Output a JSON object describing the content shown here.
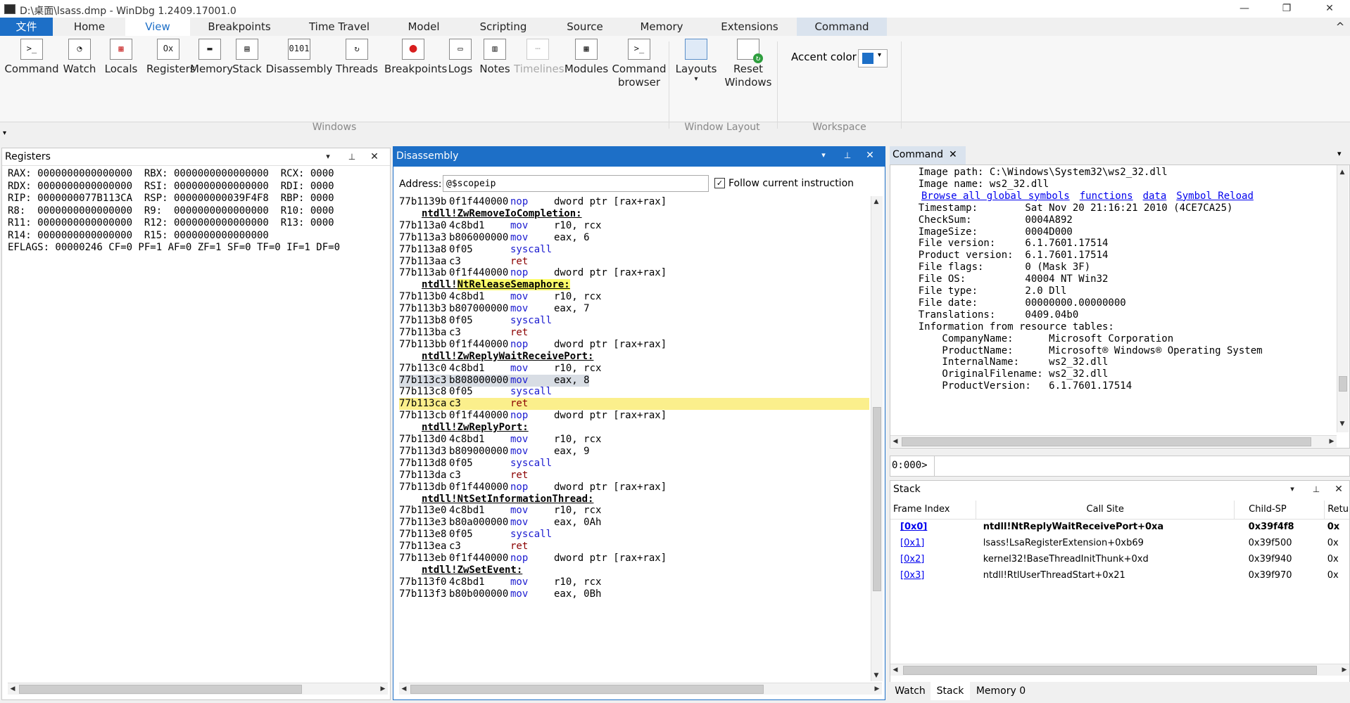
{
  "window": {
    "title": "D:\\桌面\\lsass.dmp - WinDbg 1.2409.17001.0",
    "minimize": "—",
    "maximize": "❐",
    "close": "✕",
    "collapse_ribbon": "^"
  },
  "tabs": [
    "文件",
    "Home",
    "View",
    "Breakpoints",
    "Time Travel",
    "Model",
    "Scripting",
    "Source",
    "Memory",
    "Extensions",
    "Command"
  ],
  "ribbon": {
    "windows_buttons": [
      {
        "label": "Command",
        "icon": "command-icon",
        "glyph": ">_"
      },
      {
        "label": "Watch",
        "icon": "watch-icon",
        "glyph": "◔"
      },
      {
        "label": "Locals",
        "icon": "locals-icon",
        "glyph": "▦"
      },
      {
        "label": "Registers",
        "icon": "registers-icon",
        "glyph": "Ox"
      },
      {
        "label": "Memory",
        "icon": "memory-icon",
        "glyph": "▬"
      },
      {
        "label": "Stack",
        "icon": "stack-icon",
        "glyph": "▤"
      },
      {
        "label": "Disassembly",
        "icon": "disassembly-icon",
        "glyph": "0101"
      },
      {
        "label": "Threads",
        "icon": "threads-icon",
        "glyph": "↻"
      },
      {
        "label": "Breakpoints",
        "icon": "breakpoint-icon",
        "glyph": "●"
      },
      {
        "label": "Logs",
        "icon": "logs-icon",
        "glyph": "▭"
      },
      {
        "label": "Notes",
        "icon": "notes-icon",
        "glyph": "▥"
      },
      {
        "label": "Timelines",
        "icon": "timelines-icon",
        "glyph": "⋯"
      },
      {
        "label": "Modules",
        "icon": "modules-icon",
        "glyph": "▦"
      },
      {
        "label": "Command\nbrowser",
        "icon": "command-browser-icon",
        "glyph": ">_"
      }
    ],
    "layouts_label": "Layouts",
    "layouts_arrow": "▾",
    "reset_windows_label": "Reset\nWindows",
    "accent_color_label": "Accent color",
    "accent_color": "#1d6fc7",
    "dropdown_arrow": "▾",
    "group_windows": "Windows",
    "group_window_layout": "Window Layout",
    "group_workspace": "Workspace",
    "quick_toggle": "▾"
  },
  "registers": {
    "title": "Registers",
    "dropdown": "▾",
    "pin": "📌",
    "close": "✕",
    "lines": [
      "RAX: 0000000000000000  RBX: 0000000000000000  RCX: 0000",
      "RDX: 0000000000000000  RSI: 0000000000000000  RDI: 0000",
      "RIP: 0000000077B113CA  RSP: 000000000039F4F8  RBP: 0000",
      "R8:  0000000000000000  R9:  0000000000000000  R10: 0000",
      "R11: 0000000000000000  R12: 0000000000000000  R13: 0000",
      "R14: 0000000000000000  R15: 0000000000000000",
      "EFLAGS: 00000246 CF=0 PF=1 AF=0 ZF=1 SF=0 TF=0 IF=1 DF=0"
    ]
  },
  "disassembly": {
    "title": "Disassembly",
    "dropdown": "▾",
    "pin": "📌",
    "close": "✕",
    "address_label": "Address:",
    "address_value": "@$scopeip",
    "follow_label": "Follow current instruction",
    "follow_checked": true,
    "current_line_color": "#fbef8c",
    "selected_line_color": "#d8dde4",
    "label_highlight_color": "#fdfd6a",
    "lines": [
      {
        "kind": "ins",
        "addr": "77b1139b",
        "bytes": "0f1f440000",
        "op": "nop",
        "args": "dword ptr [rax+rax]"
      },
      {
        "kind": "label",
        "text": "ntdll!ZwRemoveIoCompletion:"
      },
      {
        "kind": "ins",
        "addr": "77b113a0",
        "bytes": "4c8bd1",
        "op": "mov",
        "args": "r10, rcx"
      },
      {
        "kind": "ins",
        "addr": "77b113a3",
        "bytes": "b806000000",
        "op": "mov",
        "args": "eax, 6"
      },
      {
        "kind": "ins",
        "addr": "77b113a8",
        "bytes": "0f05",
        "op": "syscall",
        "args": ""
      },
      {
        "kind": "ins",
        "addr": "77b113aa",
        "bytes": "c3",
        "op": "ret",
        "args": ""
      },
      {
        "kind": "ins",
        "addr": "77b113ab",
        "bytes": "0f1f440000",
        "op": "nop",
        "args": "dword ptr [rax+rax]"
      },
      {
        "kind": "label",
        "text": "ntdll!NtReleaseSemaphore:",
        "prefix": "ntdll!",
        "hl": "NtReleaseSemaphore:"
      },
      {
        "kind": "ins",
        "addr": "77b113b0",
        "bytes": "4c8bd1",
        "op": "mov",
        "args": "r10, rcx"
      },
      {
        "kind": "ins",
        "addr": "77b113b3",
        "bytes": "b807000000",
        "op": "mov",
        "args": "eax, 7"
      },
      {
        "kind": "ins",
        "addr": "77b113b8",
        "bytes": "0f05",
        "op": "syscall",
        "args": ""
      },
      {
        "kind": "ins",
        "addr": "77b113ba",
        "bytes": "c3",
        "op": "ret",
        "args": ""
      },
      {
        "kind": "ins",
        "addr": "77b113bb",
        "bytes": "0f1f440000",
        "op": "nop",
        "args": "dword ptr [rax+rax]"
      },
      {
        "kind": "label",
        "text": "ntdll!ZwReplyWaitReceivePort:"
      },
      {
        "kind": "ins",
        "addr": "77b113c0",
        "bytes": "4c8bd1",
        "op": "mov",
        "args": "r10, rcx"
      },
      {
        "kind": "ins",
        "addr": "77b113c3",
        "bytes": "b808000000",
        "op": "mov",
        "args": "eax, 8",
        "selected": true
      },
      {
        "kind": "ins",
        "addr": "77b113c8",
        "bytes": "0f05",
        "op": "syscall",
        "args": ""
      },
      {
        "kind": "ins",
        "addr": "77b113ca",
        "bytes": "c3",
        "op": "ret",
        "args": "",
        "current": true
      },
      {
        "kind": "ins",
        "addr": "77b113cb",
        "bytes": "0f1f440000",
        "op": "nop",
        "args": "dword ptr [rax+rax]"
      },
      {
        "kind": "label",
        "text": "ntdll!ZwReplyPort:"
      },
      {
        "kind": "ins",
        "addr": "77b113d0",
        "bytes": "4c8bd1",
        "op": "mov",
        "args": "r10, rcx"
      },
      {
        "kind": "ins",
        "addr": "77b113d3",
        "bytes": "b809000000",
        "op": "mov",
        "args": "eax, 9"
      },
      {
        "kind": "ins",
        "addr": "77b113d8",
        "bytes": "0f05",
        "op": "syscall",
        "args": ""
      },
      {
        "kind": "ins",
        "addr": "77b113da",
        "bytes": "c3",
        "op": "ret",
        "args": ""
      },
      {
        "kind": "ins",
        "addr": "77b113db",
        "bytes": "0f1f440000",
        "op": "nop",
        "args": "dword ptr [rax+rax]"
      },
      {
        "kind": "label",
        "text": "ntdll!NtSetInformationThread:"
      },
      {
        "kind": "ins",
        "addr": "77b113e0",
        "bytes": "4c8bd1",
        "op": "mov",
        "args": "r10, rcx"
      },
      {
        "kind": "ins",
        "addr": "77b113e3",
        "bytes": "b80a000000",
        "op": "mov",
        "args": "eax, 0Ah"
      },
      {
        "kind": "ins",
        "addr": "77b113e8",
        "bytes": "0f05",
        "op": "syscall",
        "args": ""
      },
      {
        "kind": "ins",
        "addr": "77b113ea",
        "bytes": "c3",
        "op": "ret",
        "args": ""
      },
      {
        "kind": "ins",
        "addr": "77b113eb",
        "bytes": "0f1f440000",
        "op": "nop",
        "args": "dword ptr [rax+rax]"
      },
      {
        "kind": "label",
        "text": "ntdll!ZwSetEvent:"
      },
      {
        "kind": "ins",
        "addr": "77b113f0",
        "bytes": "4c8bd1",
        "op": "mov",
        "args": "r10, rcx"
      },
      {
        "kind": "ins",
        "addr": "77b113f3",
        "bytes": "b80b000000",
        "op": "mov",
        "args": "eax, 0Bh"
      }
    ]
  },
  "command": {
    "title": "Command",
    "close": "✕",
    "menu": "▾",
    "lines": [
      {
        "text": "    Image path: C:\\Windows\\System32\\ws2_32.dll"
      },
      {
        "text": "    Image name: ws2_32.dll"
      },
      {
        "links": [
          "Browse all global symbols",
          "functions",
          "data",
          "Symbol Reload"
        ]
      },
      {
        "text": "    Timestamp:        Sat Nov 20 21:16:21 2010 (4CE7CA25)"
      },
      {
        "text": "    CheckSum:         0004A892"
      },
      {
        "text": "    ImageSize:        0004D000"
      },
      {
        "text": "    File version:     6.1.7601.17514"
      },
      {
        "text": "    Product version:  6.1.7601.17514"
      },
      {
        "text": "    File flags:       0 (Mask 3F)"
      },
      {
        "text": "    File OS:          40004 NT Win32"
      },
      {
        "text": "    File type:        2.0 Dll"
      },
      {
        "text": "    File date:        00000000.00000000"
      },
      {
        "text": "    Translations:     0409.04b0"
      },
      {
        "text": "    Information from resource tables:"
      },
      {
        "text": "        CompanyName:      Microsoft Corporation"
      },
      {
        "text": "        ProductName:      Microsoft® Windows® Operating System"
      },
      {
        "text": "        InternalName:     ws2_32.dll"
      },
      {
        "text": "        OriginalFilename: ws2_32.dll"
      },
      {
        "text": "        ProductVersion:   6.1.7601.17514"
      }
    ],
    "prompt": "0:000>",
    "input_value": ""
  },
  "stack": {
    "title": "Stack",
    "dropdown": "▾",
    "pin": "📌",
    "close": "✕",
    "columns": [
      "Frame Index",
      "Call Site",
      "Child-SP",
      "Retu"
    ],
    "rows": [
      {
        "frame": "[0x0]",
        "call_site": "ntdll!NtReplyWaitReceivePort+0xa",
        "child_sp": "0x39f4f8",
        "ret": "0x",
        "bold": true
      },
      {
        "frame": "[0x1]",
        "call_site": "lsass!LsaRegisterExtension+0xb69",
        "child_sp": "0x39f500",
        "ret": "0x"
      },
      {
        "frame": "[0x2]",
        "call_site": "kernel32!BaseThreadInitThunk+0xd",
        "child_sp": "0x39f940",
        "ret": "0x"
      },
      {
        "frame": "[0x3]",
        "call_site": "ntdll!RtlUserThreadStart+0x21",
        "child_sp": "0x39f970",
        "ret": "0x"
      }
    ]
  },
  "bottom_tabs": [
    "Watch",
    "Stack",
    "Memory 0"
  ],
  "scroll": {
    "up": "▲",
    "down": "▼",
    "left": "◀",
    "right": "▶"
  }
}
